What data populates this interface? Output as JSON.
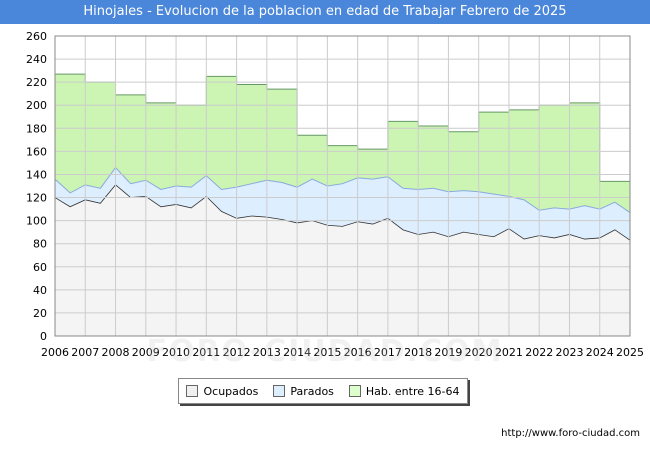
{
  "header": {
    "title": "Hinojales - Evolucion de la poblacion en edad de Trabajar Febrero de 2025"
  },
  "footer": {
    "source": "http://www.foro-ciudad.com"
  },
  "watermark": "FORO-CIUDAD.COM",
  "legend": {
    "items": [
      {
        "label": "Ocupados",
        "color": "#f0f0f0"
      },
      {
        "label": "Parados",
        "color": "#ddeeff"
      },
      {
        "label": "Hab. entre 16-64",
        "color": "#ddffcc"
      }
    ]
  },
  "chart_data": {
    "type": "area",
    "ylim": [
      0,
      260
    ],
    "yticks": [
      0,
      20,
      40,
      60,
      80,
      100,
      120,
      140,
      160,
      180,
      200,
      220,
      240,
      260
    ],
    "xlim": [
      2006,
      2025
    ],
    "xticks": [
      "2006",
      "2007",
      "2008",
      "2009",
      "2010",
      "2011",
      "2012",
      "2013",
      "2014",
      "2015",
      "2016",
      "2017",
      "2018",
      "2019",
      "2020",
      "2021",
      "2022",
      "2023",
      "2024",
      "2025"
    ],
    "grid": true,
    "legend_position": "bottom",
    "series": [
      {
        "name": "Hab. entre 16-64",
        "color": "#ccf5b3",
        "step": true,
        "x": [
          2006,
          2007,
          2008,
          2009,
          2010,
          2011,
          2012,
          2013,
          2014,
          2015,
          2016,
          2017,
          2018,
          2019,
          2020,
          2021,
          2022,
          2023,
          2024
        ],
        "values": [
          227,
          220,
          209,
          202,
          200,
          225,
          218,
          214,
          174,
          165,
          162,
          186,
          182,
          177,
          194,
          196,
          200,
          202,
          134
        ]
      },
      {
        "name": "Parados",
        "color": "#ddeeff",
        "x": [
          2006.0,
          2006.5,
          2007.0,
          2007.5,
          2008.0,
          2008.5,
          2009.0,
          2009.5,
          2010.0,
          2010.5,
          2011.0,
          2011.5,
          2012.0,
          2012.5,
          2013.0,
          2013.5,
          2014.0,
          2014.5,
          2015.0,
          2015.5,
          2016.0,
          2016.5,
          2017.0,
          2017.5,
          2018.0,
          2018.5,
          2019.0,
          2019.5,
          2020.0,
          2020.5,
          2021.0,
          2021.5,
          2022.0,
          2022.5,
          2023.0,
          2023.5,
          2024.0,
          2024.5,
          2025.0
        ],
        "values": [
          136,
          124,
          131,
          128,
          146,
          132,
          135,
          127,
          130,
          129,
          139,
          127,
          129,
          132,
          135,
          133,
          129,
          136,
          130,
          132,
          137,
          136,
          138,
          128,
          127,
          128,
          125,
          126,
          125,
          123,
          121,
          118,
          109,
          111,
          110,
          113,
          110,
          116,
          107
        ]
      },
      {
        "name": "Ocupados",
        "color": "#f4f4f4",
        "x": [
          2006.0,
          2006.5,
          2007.0,
          2007.5,
          2008.0,
          2008.5,
          2009.0,
          2009.5,
          2010.0,
          2010.5,
          2011.0,
          2011.5,
          2012.0,
          2012.5,
          2013.0,
          2013.5,
          2014.0,
          2014.5,
          2015.0,
          2015.5,
          2016.0,
          2016.5,
          2017.0,
          2017.5,
          2018.0,
          2018.5,
          2019.0,
          2019.5,
          2020.0,
          2020.5,
          2021.0,
          2021.5,
          2022.0,
          2022.5,
          2023.0,
          2023.5,
          2024.0,
          2024.5,
          2025.0
        ],
        "values": [
          120,
          112,
          118,
          115,
          131,
          120,
          121,
          112,
          114,
          111,
          121,
          108,
          102,
          104,
          103,
          101,
          98,
          100,
          96,
          95,
          99,
          97,
          102,
          92,
          88,
          90,
          86,
          90,
          88,
          86,
          93,
          84,
          87,
          85,
          88,
          84,
          85,
          92,
          83
        ]
      }
    ]
  }
}
